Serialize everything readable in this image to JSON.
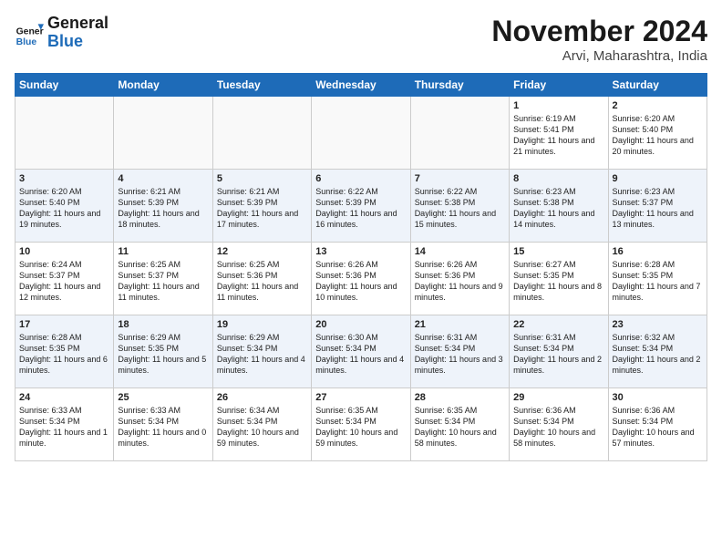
{
  "header": {
    "logo_line1": "General",
    "logo_line2": "Blue",
    "month": "November 2024",
    "location": "Arvi, Maharashtra, India"
  },
  "days_of_week": [
    "Sunday",
    "Monday",
    "Tuesday",
    "Wednesday",
    "Thursday",
    "Friday",
    "Saturday"
  ],
  "weeks": [
    [
      {
        "day": "",
        "info": ""
      },
      {
        "day": "",
        "info": ""
      },
      {
        "day": "",
        "info": ""
      },
      {
        "day": "",
        "info": ""
      },
      {
        "day": "",
        "info": ""
      },
      {
        "day": "1",
        "info": "Sunrise: 6:19 AM\nSunset: 5:41 PM\nDaylight: 11 hours\nand 21 minutes."
      },
      {
        "day": "2",
        "info": "Sunrise: 6:20 AM\nSunset: 5:40 PM\nDaylight: 11 hours\nand 20 minutes."
      }
    ],
    [
      {
        "day": "3",
        "info": "Sunrise: 6:20 AM\nSunset: 5:40 PM\nDaylight: 11 hours\nand 19 minutes."
      },
      {
        "day": "4",
        "info": "Sunrise: 6:21 AM\nSunset: 5:39 PM\nDaylight: 11 hours\nand 18 minutes."
      },
      {
        "day": "5",
        "info": "Sunrise: 6:21 AM\nSunset: 5:39 PM\nDaylight: 11 hours\nand 17 minutes."
      },
      {
        "day": "6",
        "info": "Sunrise: 6:22 AM\nSunset: 5:39 PM\nDaylight: 11 hours\nand 16 minutes."
      },
      {
        "day": "7",
        "info": "Sunrise: 6:22 AM\nSunset: 5:38 PM\nDaylight: 11 hours\nand 15 minutes."
      },
      {
        "day": "8",
        "info": "Sunrise: 6:23 AM\nSunset: 5:38 PM\nDaylight: 11 hours\nand 14 minutes."
      },
      {
        "day": "9",
        "info": "Sunrise: 6:23 AM\nSunset: 5:37 PM\nDaylight: 11 hours\nand 13 minutes."
      }
    ],
    [
      {
        "day": "10",
        "info": "Sunrise: 6:24 AM\nSunset: 5:37 PM\nDaylight: 11 hours\nand 12 minutes."
      },
      {
        "day": "11",
        "info": "Sunrise: 6:25 AM\nSunset: 5:37 PM\nDaylight: 11 hours\nand 11 minutes."
      },
      {
        "day": "12",
        "info": "Sunrise: 6:25 AM\nSunset: 5:36 PM\nDaylight: 11 hours\nand 11 minutes."
      },
      {
        "day": "13",
        "info": "Sunrise: 6:26 AM\nSunset: 5:36 PM\nDaylight: 11 hours\nand 10 minutes."
      },
      {
        "day": "14",
        "info": "Sunrise: 6:26 AM\nSunset: 5:36 PM\nDaylight: 11 hours\nand 9 minutes."
      },
      {
        "day": "15",
        "info": "Sunrise: 6:27 AM\nSunset: 5:35 PM\nDaylight: 11 hours\nand 8 minutes."
      },
      {
        "day": "16",
        "info": "Sunrise: 6:28 AM\nSunset: 5:35 PM\nDaylight: 11 hours\nand 7 minutes."
      }
    ],
    [
      {
        "day": "17",
        "info": "Sunrise: 6:28 AM\nSunset: 5:35 PM\nDaylight: 11 hours\nand 6 minutes."
      },
      {
        "day": "18",
        "info": "Sunrise: 6:29 AM\nSunset: 5:35 PM\nDaylight: 11 hours\nand 5 minutes."
      },
      {
        "day": "19",
        "info": "Sunrise: 6:29 AM\nSunset: 5:34 PM\nDaylight: 11 hours\nand 4 minutes."
      },
      {
        "day": "20",
        "info": "Sunrise: 6:30 AM\nSunset: 5:34 PM\nDaylight: 11 hours\nand 4 minutes."
      },
      {
        "day": "21",
        "info": "Sunrise: 6:31 AM\nSunset: 5:34 PM\nDaylight: 11 hours\nand 3 minutes."
      },
      {
        "day": "22",
        "info": "Sunrise: 6:31 AM\nSunset: 5:34 PM\nDaylight: 11 hours\nand 2 minutes."
      },
      {
        "day": "23",
        "info": "Sunrise: 6:32 AM\nSunset: 5:34 PM\nDaylight: 11 hours\nand 2 minutes."
      }
    ],
    [
      {
        "day": "24",
        "info": "Sunrise: 6:33 AM\nSunset: 5:34 PM\nDaylight: 11 hours\nand 1 minute."
      },
      {
        "day": "25",
        "info": "Sunrise: 6:33 AM\nSunset: 5:34 PM\nDaylight: 11 hours\nand 0 minutes."
      },
      {
        "day": "26",
        "info": "Sunrise: 6:34 AM\nSunset: 5:34 PM\nDaylight: 10 hours\nand 59 minutes."
      },
      {
        "day": "27",
        "info": "Sunrise: 6:35 AM\nSunset: 5:34 PM\nDaylight: 10 hours\nand 59 minutes."
      },
      {
        "day": "28",
        "info": "Sunrise: 6:35 AM\nSunset: 5:34 PM\nDaylight: 10 hours\nand 58 minutes."
      },
      {
        "day": "29",
        "info": "Sunrise: 6:36 AM\nSunset: 5:34 PM\nDaylight: 10 hours\nand 58 minutes."
      },
      {
        "day": "30",
        "info": "Sunrise: 6:36 AM\nSunset: 5:34 PM\nDaylight: 10 hours\nand 57 minutes."
      }
    ]
  ]
}
